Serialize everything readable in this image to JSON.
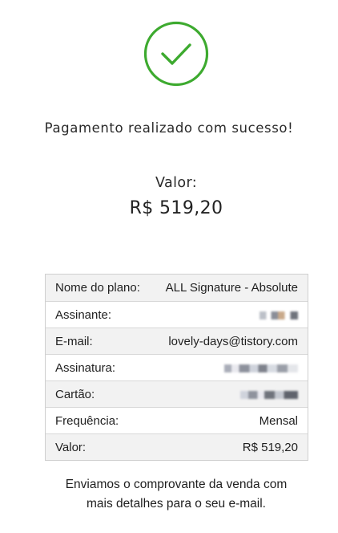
{
  "status": {
    "icon": "check-circle-icon",
    "color": "#3daa2f",
    "message": "Pagamento realizado com sucesso!"
  },
  "amount": {
    "label": "Valor:",
    "value": "R$ 519,20"
  },
  "details": [
    {
      "key": "Nome do plano:",
      "value": "ALL Signature - Absolute",
      "redacted": false
    },
    {
      "key": "Assinante:",
      "value": "",
      "redacted": true
    },
    {
      "key": "E-mail:",
      "value": "lovely-days@tistory.com",
      "redacted": false
    },
    {
      "key": "Assinatura:",
      "value": "",
      "redacted": true
    },
    {
      "key": "Cartão:",
      "value": "",
      "redacted": true
    },
    {
      "key": "Frequência:",
      "value": "Mensal",
      "redacted": false
    },
    {
      "key": "Valor:",
      "value": "R$ 519,20",
      "redacted": false
    }
  ],
  "footer": {
    "line1": "Enviamos o comprovante da venda com",
    "line2": "mais detalhes para o seu e-mail."
  }
}
